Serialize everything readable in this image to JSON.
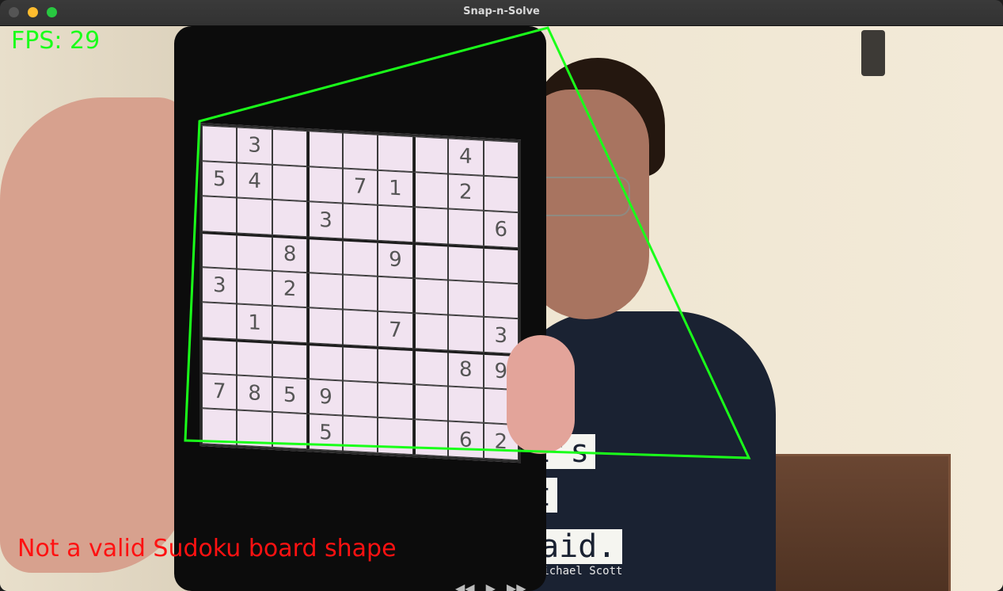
{
  "window": {
    "title": "Snap-n-Solve"
  },
  "overlay": {
    "fps_label": "FPS: 29",
    "status_message": "Not a valid Sudoku board shape",
    "status_color": "#ff1111",
    "fps_color": "#1aff1a",
    "contour_color": "#1aff1a"
  },
  "shirt": {
    "line1": "at's",
    "line2": "at",
    "line3": "said.",
    "credit": "- Michael Scott"
  },
  "sudoku": {
    "rows": [
      [
        "",
        "3",
        "",
        "",
        "",
        "",
        "",
        "4",
        ""
      ],
      [
        "5",
        "4",
        "",
        "",
        "7",
        "1",
        "",
        "2",
        ""
      ],
      [
        "",
        "",
        "",
        "3",
        "",
        "",
        "",
        "",
        "6"
      ],
      [
        "",
        "",
        "8",
        "",
        "",
        "9",
        "",
        "",
        ""
      ],
      [
        "3",
        "",
        "2",
        "",
        "",
        "",
        "",
        "",
        ""
      ],
      [
        "",
        "1",
        "",
        "",
        "",
        "7",
        "",
        "",
        "3"
      ],
      [
        "",
        "",
        "",
        "",
        "",
        "",
        "",
        "8",
        "9"
      ],
      [
        "7",
        "8",
        "5",
        "9",
        "",
        "",
        "",
        "",
        ""
      ],
      [
        "",
        "",
        "",
        "5",
        "",
        "",
        "",
        "6",
        "2"
      ]
    ]
  },
  "icons": {
    "rewind": "rewind-icon",
    "play": "play-icon",
    "forward": "fast-forward-icon"
  }
}
